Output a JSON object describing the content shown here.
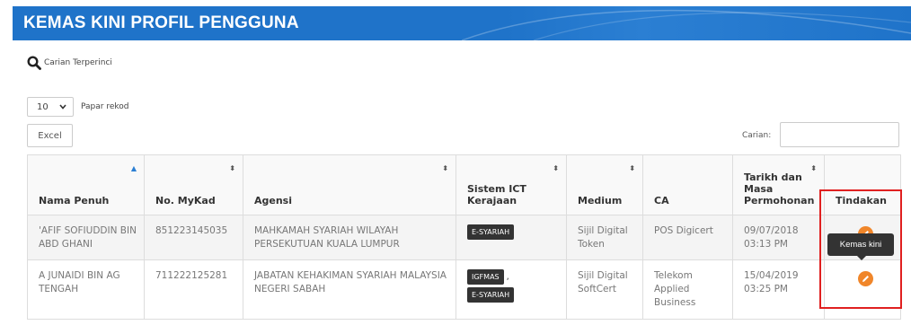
{
  "page": {
    "title": "KEMAS KINI PROFIL PENGGUNA"
  },
  "advanced_search": {
    "label": "Carian Terperinci",
    "icon": "search-icon"
  },
  "page_length": {
    "selected": "10",
    "label": "Papar rekod"
  },
  "toolbar": {
    "excel_label": "Excel"
  },
  "search": {
    "label": "Carian:",
    "value": ""
  },
  "table": {
    "columns": [
      {
        "label": "Nama Penuh",
        "sort": "asc"
      },
      {
        "label": "No. MyKad",
        "sort": "both"
      },
      {
        "label": "Agensi",
        "sort": "both"
      },
      {
        "label": "Sistem ICT Kerajaan",
        "sort": "both"
      },
      {
        "label": "Medium",
        "sort": "both"
      },
      {
        "label": "CA",
        "sort": "none"
      },
      {
        "label": "Tarikh dan Masa Permohonan",
        "sort": "both"
      },
      {
        "label": "Tindakan",
        "sort": "none"
      }
    ],
    "rows": [
      {
        "nama": "'AFIF SOFIUDDIN BIN ABD GHANI",
        "mykad": "851223145035",
        "agensi": "MAHKAMAH SYARIAH WILAYAH PERSEKUTUAN KUALA LUMPUR",
        "sistem": [
          "E-SYARIAH"
        ],
        "medium": "Sijil Digital Token",
        "ca": "POS Digicert",
        "tarikh": "09/07/2018 03:13 PM"
      },
      {
        "nama": "A JUNAIDI BIN AG TENGAH",
        "mykad": "711222125281",
        "agensi": "JABATAN KEHAKIMAN SYARIAH MALAYSIA NEGERI SABAH",
        "sistem": [
          "IGFMAS",
          "E-SYARIAH"
        ],
        "sistem_separator": ",",
        "medium": "Sijil Digital SoftCert",
        "ca": "Telekom Applied Business",
        "tarikh": "15/04/2019 03:25 PM"
      }
    ]
  },
  "tooltip": {
    "text": "Kemas kini"
  },
  "colors": {
    "header": "#1f73c9",
    "edit_button": "#f0862a",
    "highlight": "#e02020"
  }
}
